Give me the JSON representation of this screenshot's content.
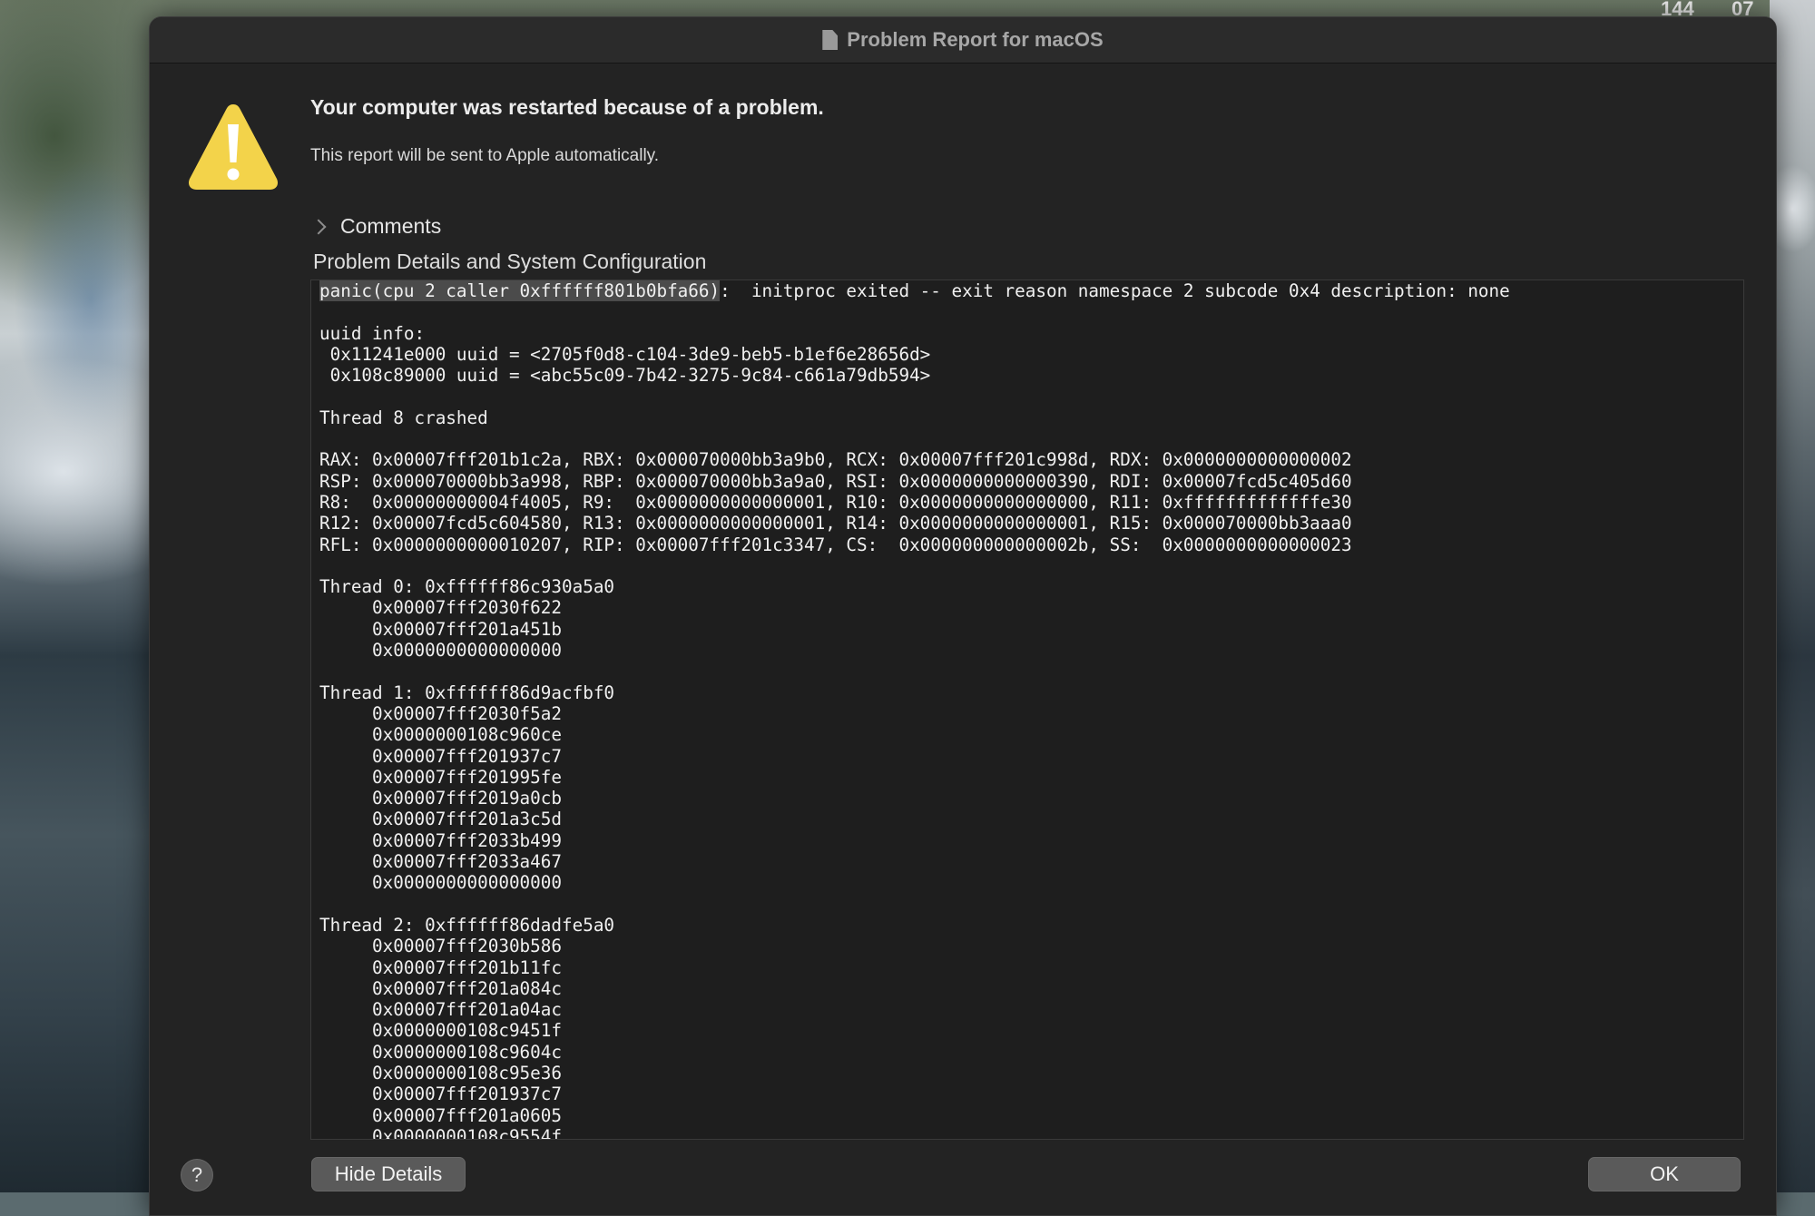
{
  "menubar": {
    "left_value": "144",
    "right_value": "07"
  },
  "window": {
    "title": "Problem Report for macOS",
    "icon": "document-icon",
    "headline": "Your computer was restarted because of a problem.",
    "subline": "This report will be sent to Apple automatically.",
    "warning_icon": "warning-icon",
    "comments_label": "Comments",
    "section_title": "Problem Details and System Configuration",
    "details": {
      "selected_prefix": "panic(cpu 2 caller 0xffffff801b0bfa66)",
      "first_line_rest": ":  initproc exited -- exit reason namespace 2 subcode 0x4 description: none",
      "body": "\nuuid info:\n 0x11241e000 uuid = <2705f0d8-c104-3de9-beb5-b1ef6e28656d>\n 0x108c89000 uuid = <abc55c09-7b42-3275-9c84-c661a79db594>\n\nThread 8 crashed\n\nRAX: 0x00007fff201b1c2a, RBX: 0x000070000bb3a9b0, RCX: 0x00007fff201c998d, RDX: 0x0000000000000002\nRSP: 0x000070000bb3a998, RBP: 0x000070000bb3a9a0, RSI: 0x0000000000000390, RDI: 0x00007fcd5c405d60\nR8:  0x00000000004f4005, R9:  0x0000000000000001, R10: 0x0000000000000000, R11: 0xfffffffffffffe30\nR12: 0x00007fcd5c604580, R13: 0x0000000000000001, R14: 0x0000000000000001, R15: 0x000070000bb3aaa0\nRFL: 0x0000000000010207, RIP: 0x00007fff201c3347, CS:  0x000000000000002b, SS:  0x0000000000000023\n\nThread 0: 0xffffff86c930a5a0\n     0x00007fff2030f622\n     0x00007fff201a451b\n     0x0000000000000000\n\nThread 1: 0xffffff86d9acfbf0\n     0x00007fff2030f5a2\n     0x0000000108c960ce\n     0x00007fff201937c7\n     0x00007fff201995fe\n     0x00007fff2019a0cb\n     0x00007fff201a3c5d\n     0x00007fff2033b499\n     0x00007fff2033a467\n     0x0000000000000000\n\nThread 2: 0xffffff86dadfe5a0\n     0x00007fff2030b586\n     0x00007fff201b11fc\n     0x00007fff201a084c\n     0x00007fff201a04ac\n     0x0000000108c9451f\n     0x0000000108c9604c\n     0x0000000108c95e36\n     0x00007fff201937c7\n     0x00007fff201a0605\n     0x0000000108c9554f"
    },
    "help_label": "?",
    "hide_details_label": "Hide Details",
    "ok_label": "OK"
  }
}
